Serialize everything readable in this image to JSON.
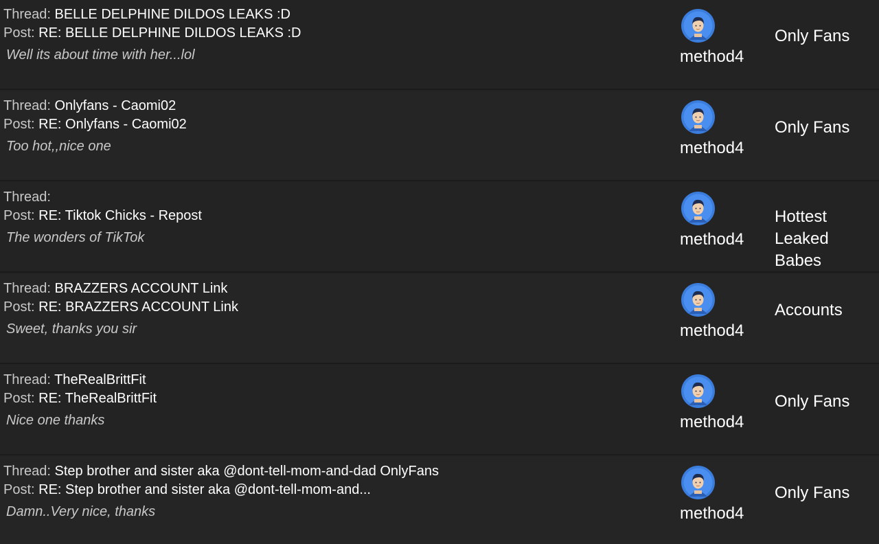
{
  "labels": {
    "thread": "Thread:",
    "post": "Post:"
  },
  "rows": [
    {
      "thread": "BELLE DELPHINE DILDOS LEAKS :D",
      "post": "RE: BELLE DELPHINE DILDOS LEAKS :D",
      "excerpt": "Well its about time with her...lol",
      "user": "method4",
      "forum": "Only Fans"
    },
    {
      "thread": "Onlyfans - Caomi02",
      "post": "RE: Onlyfans - Caomi02",
      "excerpt": "Too hot,,nice one",
      "user": "method4",
      "forum": "Only Fans"
    },
    {
      "thread": "",
      "post": "RE: Tiktok Chicks - Repost",
      "excerpt": "The wonders of TikTok",
      "user": "method4",
      "forum": "Hottest Leaked Babes"
    },
    {
      "thread": "BRAZZERS ACCOUNT Link",
      "post": "RE: BRAZZERS ACCOUNT Link",
      "excerpt": "Sweet, thanks you sir",
      "user": "method4",
      "forum": "Accounts"
    },
    {
      "thread": "TheRealBrittFit",
      "post": "RE: TheRealBrittFit",
      "excerpt": "Nice one thanks",
      "user": "method4",
      "forum": "Only Fans"
    },
    {
      "thread": "Step brother and sister aka @dont-tell-mom-and-dad OnlyFans",
      "post": "RE: Step brother and sister aka @dont-tell-mom-and...",
      "excerpt": "Damn..Very nice, thanks",
      "user": "method4",
      "forum": "Only Fans"
    }
  ],
  "icons": {
    "avatar": "default-user-avatar-icon"
  },
  "colors": {
    "background": "#232323",
    "avatar_ring": "#3b7ddd"
  }
}
